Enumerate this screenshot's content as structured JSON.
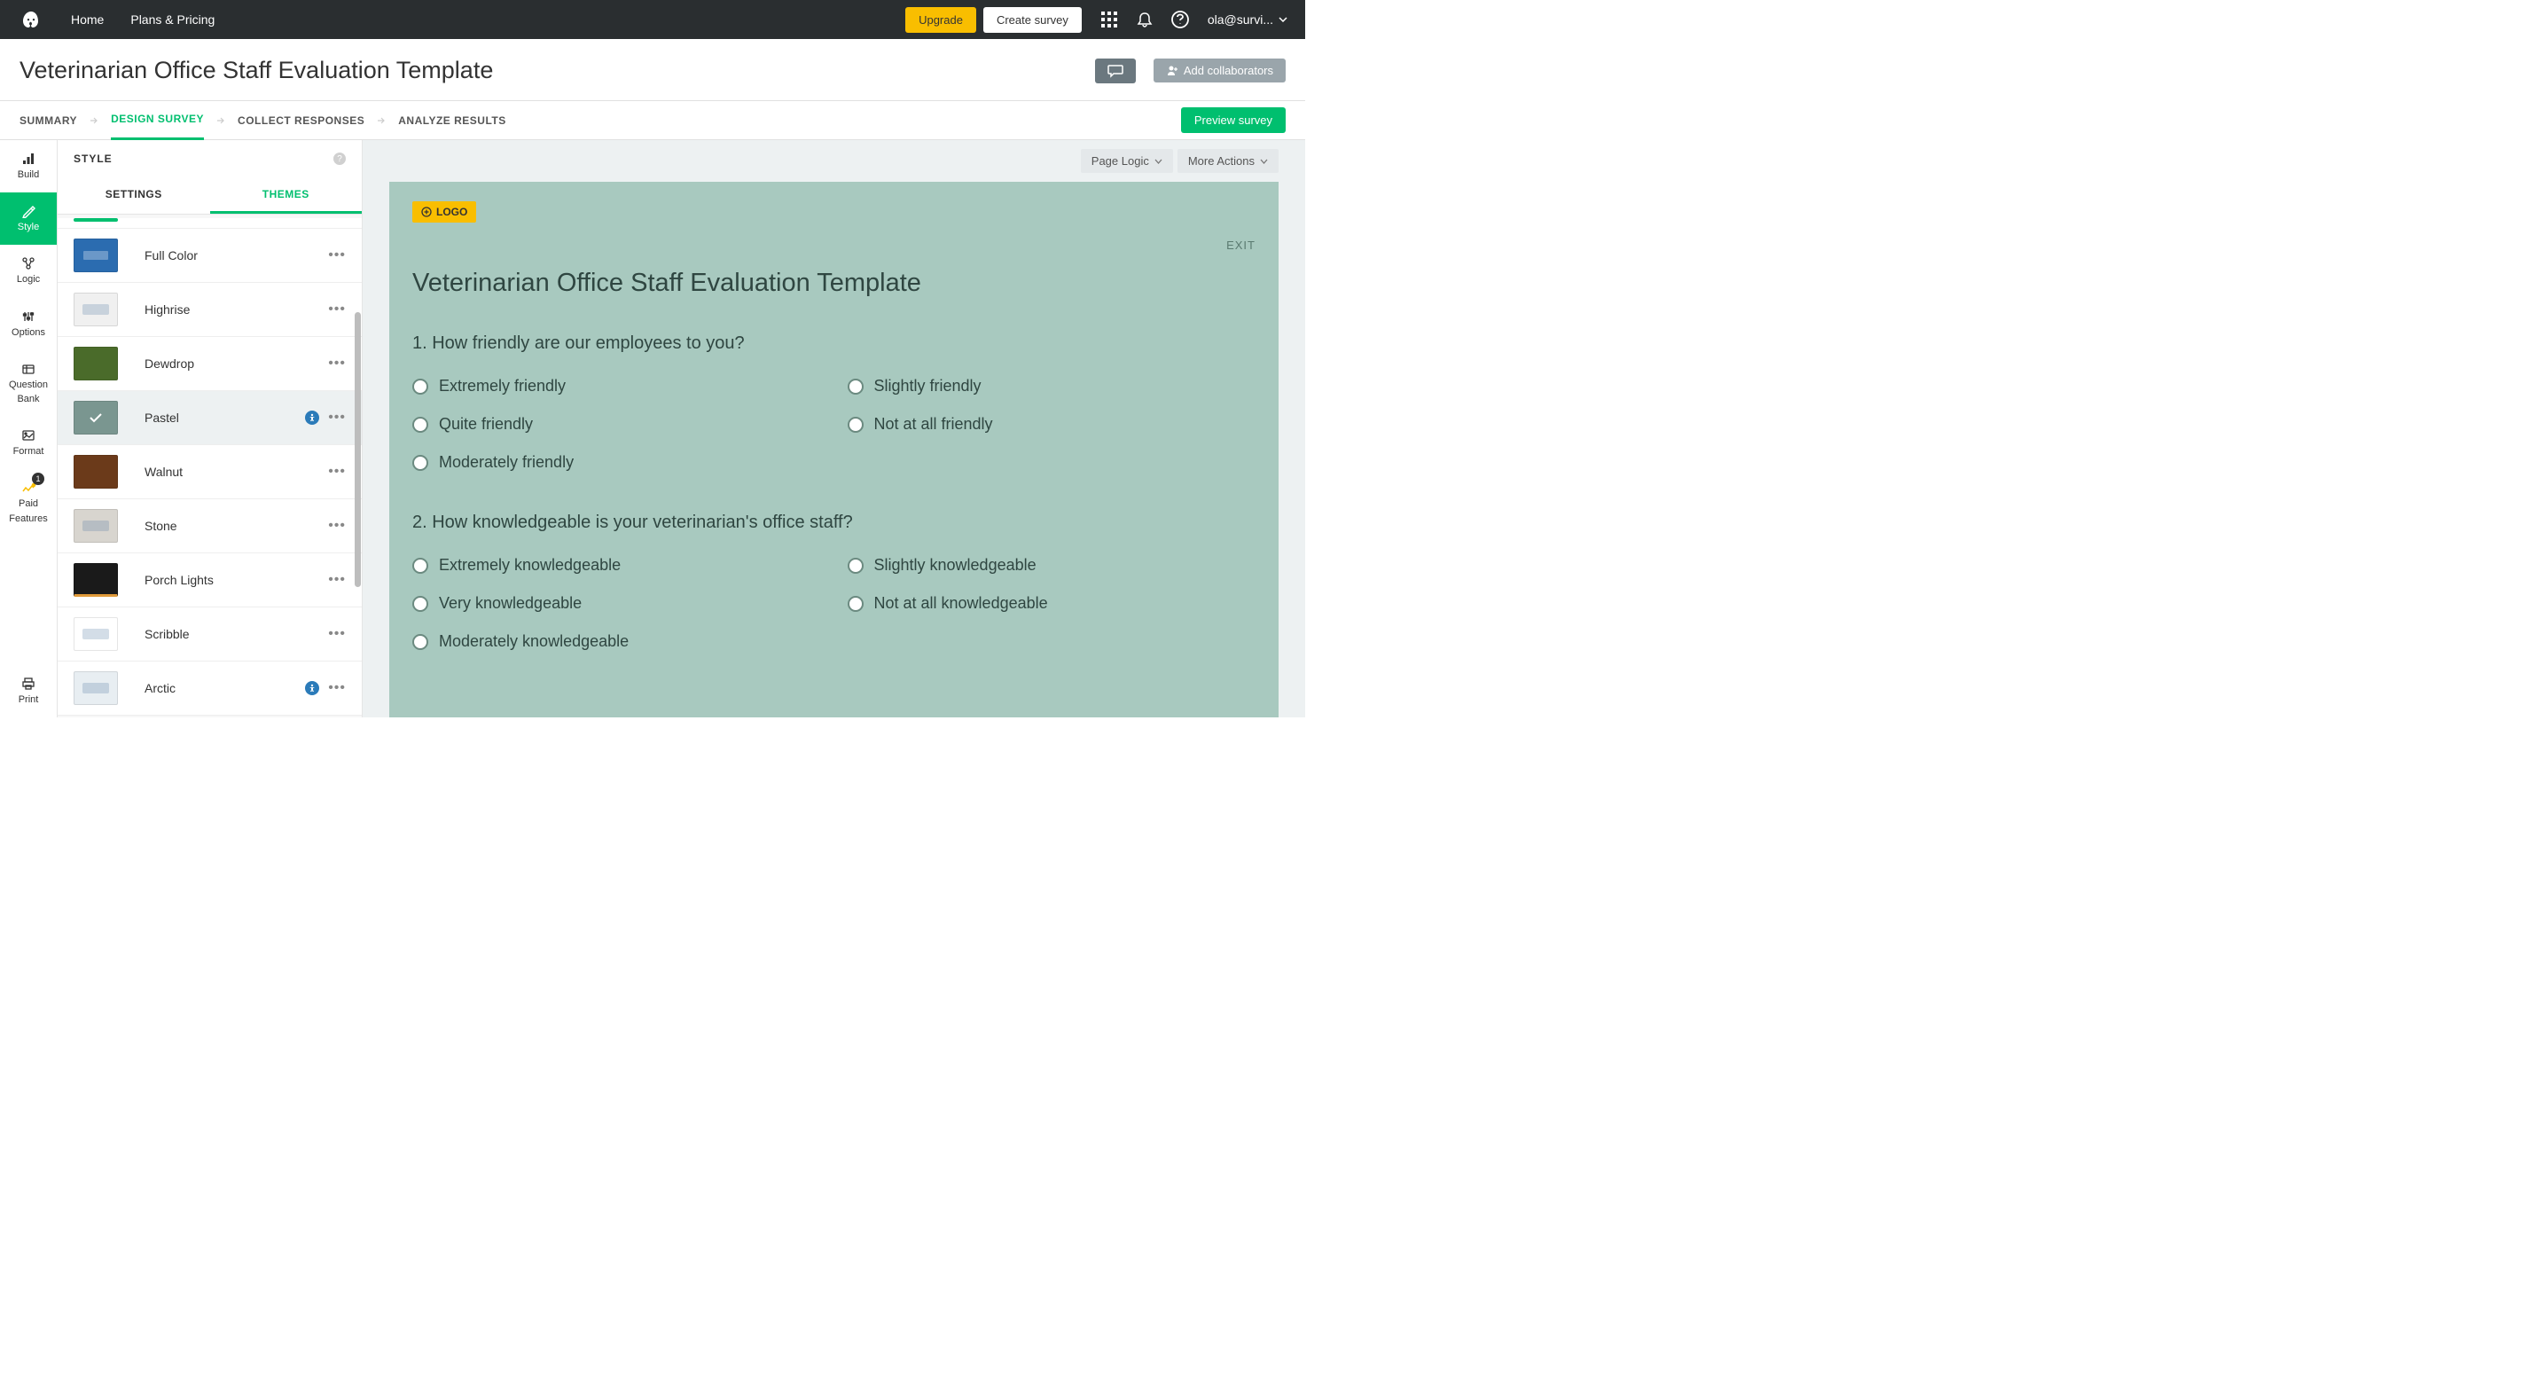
{
  "nav": {
    "home": "Home",
    "plans": "Plans & Pricing",
    "upgrade": "Upgrade",
    "create": "Create survey",
    "user": "ola@survi..."
  },
  "title": "Veterinarian Office Staff Evaluation Template",
  "titlebar": {
    "collab": "Add collaborators"
  },
  "tabs": {
    "summary": "SUMMARY",
    "design": "DESIGN SURVEY",
    "collect": "COLLECT RESPONSES",
    "analyze": "ANALYZE RESULTS",
    "preview": "Preview survey"
  },
  "rail": {
    "build": "Build",
    "style": "Style",
    "logic": "Logic",
    "options": "Options",
    "qbank1": "Question",
    "qbank2": "Bank",
    "format": "Format",
    "paid1": "Paid",
    "paid2": "Features",
    "paidBadge": "1",
    "print": "Print"
  },
  "stylePanel": {
    "header": "STYLE",
    "settings": "SETTINGS",
    "themes": "THEMES"
  },
  "themes": [
    {
      "name": "Full Color",
      "bg": "#2b6cb0",
      "access": false,
      "selected": false
    },
    {
      "name": "Highrise",
      "bg": "#f0f0f0",
      "access": false,
      "selected": false
    },
    {
      "name": "Dewdrop",
      "bg": "#4a6b2a",
      "access": false,
      "selected": false
    },
    {
      "name": "Pastel",
      "bg": "#7a9690",
      "access": true,
      "selected": true
    },
    {
      "name": "Walnut",
      "bg": "#6b3a1a",
      "access": false,
      "selected": false
    },
    {
      "name": "Stone",
      "bg": "#d8d5cf",
      "access": false,
      "selected": false
    },
    {
      "name": "Porch Lights",
      "bg": "#1a1a1a",
      "access": false,
      "selected": false
    },
    {
      "name": "Scribble",
      "bg": "#ffffff",
      "access": false,
      "selected": false
    },
    {
      "name": "Arctic",
      "bg": "#e8eef2",
      "access": true,
      "selected": false
    }
  ],
  "canvas": {
    "pageLogic": "Page Logic",
    "moreActions": "More Actions",
    "logoBtn": "LOGO",
    "exit": "EXIT",
    "surveyTitle": "Veterinarian Office Staff Evaluation Template"
  },
  "questions": [
    {
      "number": "1.",
      "text": "How friendly are our employees to you?",
      "options": [
        "Extremely friendly",
        "Slightly friendly",
        "Quite friendly",
        "Not at all friendly",
        "Moderately friendly"
      ]
    },
    {
      "number": "2.",
      "text": "How knowledgeable is your veterinarian's office staff?",
      "options": [
        "Extremely knowledgeable",
        "Slightly knowledgeable",
        "Very knowledgeable",
        "Not at all knowledgeable",
        "Moderately knowledgeable"
      ]
    }
  ]
}
